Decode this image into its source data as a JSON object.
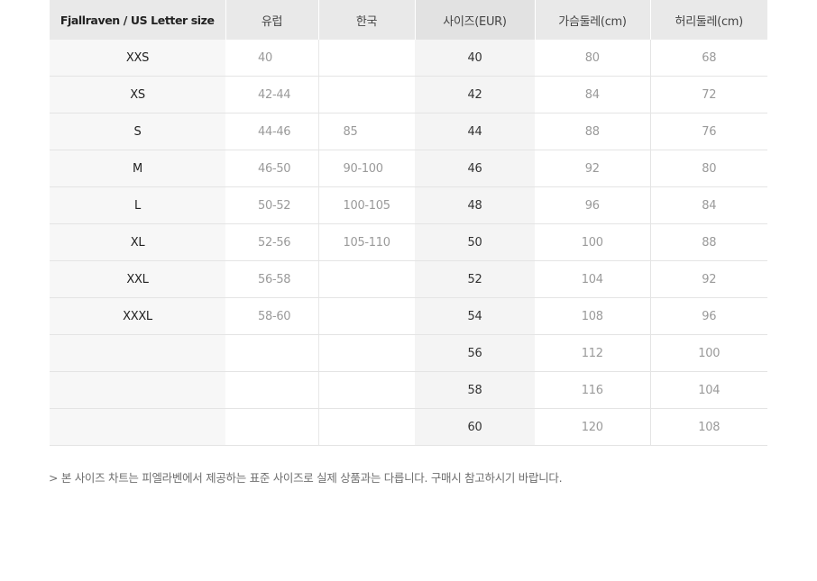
{
  "table": {
    "headers": [
      "Fjallraven / US Letter size",
      "유럽",
      "한국",
      "사이즈(EUR)",
      "가슴둘레(cm)",
      "허리둘레(cm)"
    ],
    "rows": [
      {
        "letter": "XXS",
        "eu": "40",
        "kr": "",
        "eur": "40",
        "chest": "80",
        "waist": "68"
      },
      {
        "letter": "XS",
        "eu": "42-44",
        "kr": "",
        "eur": "42",
        "chest": "84",
        "waist": "72"
      },
      {
        "letter": "S",
        "eu": "44-46",
        "kr": "85",
        "eur": "44",
        "chest": "88",
        "waist": "76"
      },
      {
        "letter": "M",
        "eu": "46-50",
        "kr": "90-100",
        "eur": "46",
        "chest": "92",
        "waist": "80"
      },
      {
        "letter": "L",
        "eu": "50-52",
        "kr": "100-105",
        "eur": "48",
        "chest": "96",
        "waist": "84"
      },
      {
        "letter": "XL",
        "eu": "52-56",
        "kr": "105-110",
        "eur": "50",
        "chest": "100",
        "waist": "88"
      },
      {
        "letter": "XXL",
        "eu": "56-58",
        "kr": "",
        "eur": "52",
        "chest": "104",
        "waist": "92"
      },
      {
        "letter": "XXXL",
        "eu": "58-60",
        "kr": "",
        "eur": "54",
        "chest": "108",
        "waist": "96"
      },
      {
        "letter": "",
        "eu": "",
        "kr": "",
        "eur": "56",
        "chest": "112",
        "waist": "100"
      },
      {
        "letter": "",
        "eu": "",
        "kr": "",
        "eur": "58",
        "chest": "116",
        "waist": "104"
      },
      {
        "letter": "",
        "eu": "",
        "kr": "",
        "eur": "60",
        "chest": "120",
        "waist": "108"
      }
    ]
  },
  "note": "> 본 사이즈 차트는 피엘라벤에서 제공하는 표준 사이즈로 실제 상품과는 다릅니다. 구매시 참고하시기 바랍니다."
}
